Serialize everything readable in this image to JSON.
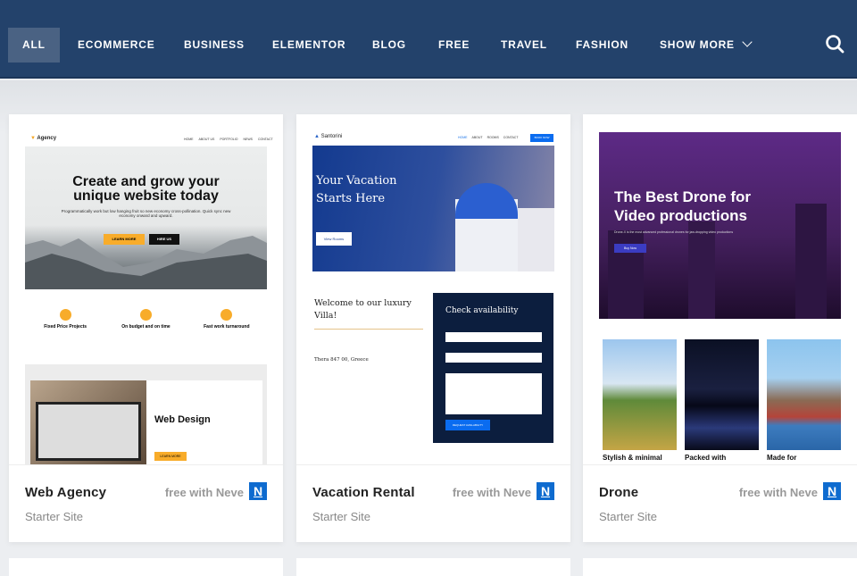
{
  "nav": {
    "items": [
      {
        "label": "All"
      },
      {
        "label": "Ecommerce"
      },
      {
        "label": "Business"
      },
      {
        "label": "Elementor"
      },
      {
        "label": "Blog"
      },
      {
        "label": "Free"
      },
      {
        "label": "Travel"
      },
      {
        "label": "Fashion"
      },
      {
        "label": "Show more"
      }
    ]
  },
  "cards": [
    {
      "title": "Web Agency",
      "subtitle": "Starter Site",
      "badge": "free with Neve",
      "logo": "N",
      "preview": {
        "brand": "Agency",
        "menu": [
          "HOME",
          "ABOUT US",
          "PORTFOLIO",
          "NEWS",
          "CONTACT"
        ],
        "headline": "Create and grow your unique website today",
        "text": "Programmatically work but low hanging fruit so new economy cross-pollination. Quick sync new economy onward and upward.",
        "btn1": "LEARN MORE",
        "btn2": "HIRE US",
        "features": [
          "Fixed Price Projects",
          "On budget and on time",
          "Fast work turnaround"
        ],
        "section_title": "Web Design",
        "section_btn": "LEARN MORE"
      }
    },
    {
      "title": "Vacation Rental",
      "subtitle": "Starter Site",
      "badge": "free with Neve",
      "logo": "N",
      "preview": {
        "brand": "Santorini",
        "menu": [
          "HOME",
          "ABOUT",
          "ROOMS",
          "CONTACT"
        ],
        "cta": "BOOK NOW",
        "headline": "Your Vacation Starts Here",
        "btn": "View Rooms",
        "welcome": "Welcome to our luxury Villa!",
        "address": "Thera 847 00, Greece",
        "form_title": "Check availability",
        "form_btn": "REQUEST AVAILABILITY"
      }
    },
    {
      "title": "Drone",
      "subtitle": "Starter Site",
      "badge": "free with Neve",
      "logo": "N",
      "preview": {
        "headline": "The Best Drone for Video productions",
        "text": "Drone-X is the most advanced professional drones for jaw-dropping video productions",
        "btn": "Buy Now",
        "features": [
          "Stylish & minimal",
          "Packed with",
          "Made for"
        ]
      }
    }
  ]
}
